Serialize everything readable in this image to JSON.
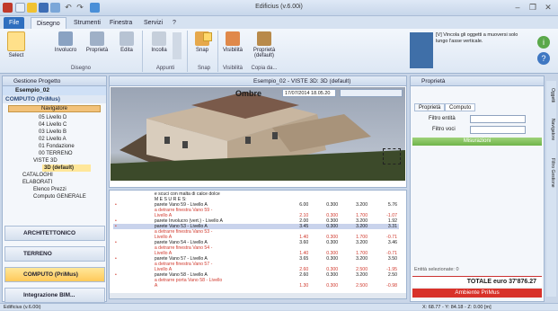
{
  "window": {
    "title": "Edificius (v.6.00i)"
  },
  "menu_tabs": [
    "File",
    "Disegno",
    "Strumenti",
    "Finestra",
    "Servizi",
    "?"
  ],
  "ribbon": {
    "select": "Select",
    "involucro": "Involucro",
    "proprieta": "Proprietà",
    "edita": "Edita",
    "incolla": "Incolla",
    "snap": "Snap",
    "visibilita": "Visibilità",
    "proprieta_default": "Proprietà (default)",
    "groups": {
      "disegno": "Disegno",
      "appunti": "Appunti",
      "snap": "Snap",
      "visibilita": "Visibilità",
      "copia": "Copia da..."
    },
    "hint_code": "[V]",
    "hint_text": "Vincola gli oggetti a muoversi solo lungo l'asse verticale."
  },
  "left_panel": {
    "title": "Gestione Progetto",
    "project": "Esempio_02",
    "computo_header": "COMPUTO (PriMus)",
    "navigatore": "Navigatore",
    "tree": [
      "05 Livello D",
      "04 Livello C",
      "03 Livello B",
      "02 Livello A",
      "01 Fondazione",
      "00 TERRENO",
      "VISTE 3D",
      "3D (default)",
      "CATALOGHI",
      "ELABORATI",
      "Elenco Prezzi",
      "Computo GENERALE"
    ],
    "nav_buttons": [
      "ARCHITETTONICO",
      "TERRENO",
      "COMPUTO (PriMus)",
      "Integrazione BIM..."
    ]
  },
  "viewport": {
    "title": "Esempio_02 - VISTE 3D: 3D (default)",
    "label": "Ombre",
    "datetime": "17/07/2014 18.05.20"
  },
  "computo_table": {
    "rows": [
      {
        "desc": "e scuci con malta di calce dolce",
        "a": "",
        "b": "",
        "c": "",
        "d": "",
        "red": false,
        "hl": false
      },
      {
        "desc": "M E S U R E S:",
        "a": "",
        "b": "",
        "c": "",
        "d": "",
        "red": false,
        "hl": false
      },
      {
        "desc": "parete Vano 59 - Livello A",
        "a": "6.00",
        "b": "0.300",
        "c": "3.200",
        "d": "5.76",
        "red": false,
        "hl": false
      },
      {
        "desc": "a detrarre finestra Vano 59 -",
        "a": "",
        "b": "",
        "c": "",
        "d": "",
        "red": true,
        "hl": false
      },
      {
        "desc": "Livello A",
        "a": "2.10",
        "b": "0.300",
        "c": "1.700",
        "d": "-1.07",
        "red": true,
        "hl": false
      },
      {
        "desc": "parete Involucro (vert.) - Livello A",
        "a": "2.00",
        "b": "0.300",
        "c": "3.200",
        "d": "1.92",
        "red": false,
        "hl": false
      },
      {
        "desc": "parete Vano 53 - Livello A",
        "a": "3.45",
        "b": "0.300",
        "c": "3.200",
        "d": "3.31",
        "red": false,
        "hl": true
      },
      {
        "desc": "a detrarre finestra Vano 53 -",
        "a": "",
        "b": "",
        "c": "",
        "d": "",
        "red": true,
        "hl": false
      },
      {
        "desc": "Livello A",
        "a": "1.40",
        "b": "0.300",
        "c": "1.700",
        "d": "-0.71",
        "red": true,
        "hl": false
      },
      {
        "desc": "parete Vano 54 - Livello A",
        "a": "3.60",
        "b": "0.300",
        "c": "3.200",
        "d": "3.46",
        "red": false,
        "hl": false
      },
      {
        "desc": "a detrarre finestra Vano 54 -",
        "a": "",
        "b": "",
        "c": "",
        "d": "",
        "red": true,
        "hl": false
      },
      {
        "desc": "Livello A",
        "a": "1.40",
        "b": "0.300",
        "c": "1.700",
        "d": "-0.71",
        "red": true,
        "hl": false
      },
      {
        "desc": "parete Vano 57 - Livello A",
        "a": "3.65",
        "b": "0.300",
        "c": "3.200",
        "d": "3.50",
        "red": false,
        "hl": false
      },
      {
        "desc": "a detrarre finestra Vano 57 -",
        "a": "",
        "b": "",
        "c": "",
        "d": "",
        "red": true,
        "hl": false
      },
      {
        "desc": "Livello A",
        "a": "2.60",
        "b": "0.300",
        "c": "2.500",
        "d": "-1.95",
        "red": true,
        "hl": false
      },
      {
        "desc": "parete Vano 58 - Livello A",
        "a": "2.60",
        "b": "0.300",
        "c": "3.200",
        "d": "2.50",
        "red": false,
        "hl": false
      },
      {
        "desc": "a detrarre porta Vano 58 - Livello",
        "a": "",
        "b": "",
        "c": "",
        "d": "",
        "red": true,
        "hl": false
      },
      {
        "desc": "A",
        "a": "1.30",
        "b": "0.300",
        "c": "2.500",
        "d": "-0.98",
        "red": true,
        "hl": false
      }
    ]
  },
  "right_panel": {
    "title": "Proprietà",
    "tabs": [
      "Proprietà",
      "Computo"
    ],
    "filtro_entita": "Filtro entità",
    "filtro_voci": "Filtro voci",
    "misurazioni": "Misurazioni",
    "entita_sel": "Entità selezionate: 0",
    "totale": "TOTALE euro 37'876.27",
    "ambiente": "Ambiente PriMus"
  },
  "side_tabs": [
    "Oggetti",
    "Navigatore",
    "Filtro Gestione"
  ],
  "status": {
    "left": "Edificius (v.6.00i)",
    "coords": "X: 68.77 - Y: 84.18 - Z: 0.00 [m]"
  }
}
